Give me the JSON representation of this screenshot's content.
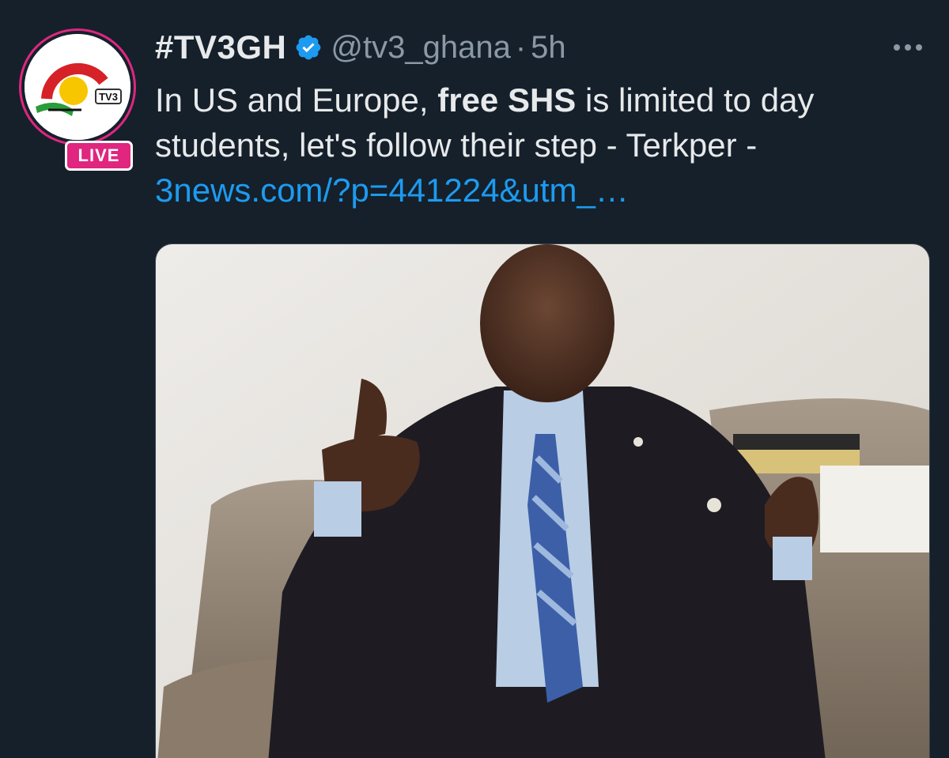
{
  "tweet": {
    "display_name": "#TV3GH",
    "handle": "@tv3_ghana",
    "separator": "·",
    "timestamp": "5h",
    "text_before_bold": "In US and Europe, ",
    "text_bold": "free SHS",
    "text_after_bold": " is limited to day students, let's follow their step - Terkper -",
    "link_text": "3news.com/?p=441224&utm_…",
    "more_icon": "more-horizontal-icon",
    "verified_icon": "verified-badge-icon"
  },
  "avatar": {
    "logo_text": "TV3",
    "live_label": "LIVE",
    "ring_color": "#e0267f"
  },
  "colors": {
    "background": "#15202b",
    "primary_text": "#e7e9ea",
    "secondary_text": "#8b98a5",
    "link": "#1d9bf0",
    "verified": "#1d9bf0"
  }
}
